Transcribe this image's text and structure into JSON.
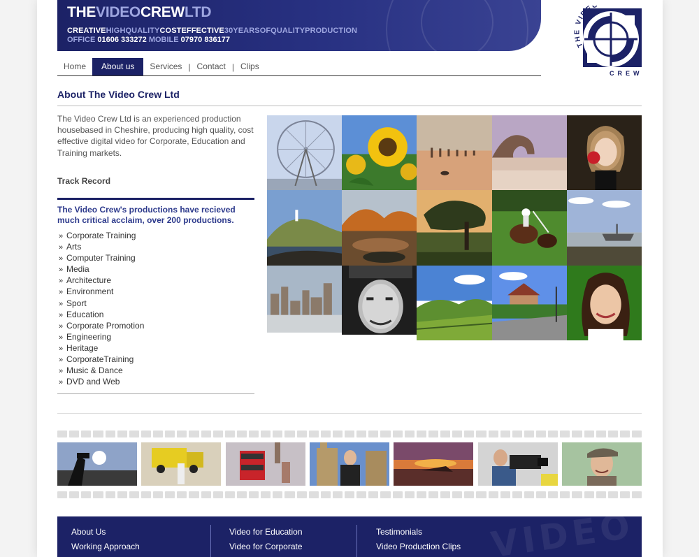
{
  "header": {
    "brand": [
      {
        "text": "THE",
        "tone": "w"
      },
      {
        "text": "VIDEO",
        "tone": "b"
      },
      {
        "text": "CREW",
        "tone": "w"
      },
      {
        "text": "LTD",
        "tone": "b"
      }
    ],
    "tagline": [
      {
        "text": "CREATIVE",
        "tone": "w"
      },
      {
        "text": "HIGHQUALITY",
        "tone": "b"
      },
      {
        "text": "COSTEFFECTIVE",
        "tone": "w"
      },
      {
        "text": "30YEARSOFQUALITYPRODUCTION",
        "tone": "b"
      }
    ],
    "office_label": "OFFICE",
    "office_number": "01606 333272",
    "mobile_label": "MOBILE",
    "mobile_number": "07970 836177",
    "logo_text_top": "THE VIDEO",
    "logo_text_bottom": "CREW"
  },
  "nav": {
    "items": [
      {
        "label": "Home",
        "active": false
      },
      {
        "label": "About us",
        "active": true
      },
      {
        "label": "Services",
        "active": false
      },
      {
        "label": "Contact",
        "active": false
      },
      {
        "label": "Clips",
        "active": false
      }
    ]
  },
  "main": {
    "heading": "About The Video Crew Ltd",
    "intro": "The Video Crew Ltd is an experienced production housebased in Cheshire, producing high quality, cost effective digital video for Corporate, Education and Training markets.",
    "track_record_title": "Track Record",
    "acclaim": "The Video Crew's productions have recieved much critical acclaim, over 200 productions.",
    "list_marker": "»",
    "track_list": [
      "Corporate Training",
      "Arts",
      "Computer Training",
      "Media",
      "Architecture",
      "Environment",
      "Sport",
      "Education",
      "Corporate Promotion",
      "Engineering",
      "Heritage",
      "CorporateTraining",
      "Music & Dance",
      "DVD and Web"
    ]
  },
  "photo_grid": [
    "ferris-wheel",
    "sunflower",
    "beach-groynes",
    "rock-arch",
    "woman-red-flower",
    "coastal-lighthouse",
    "autumn-river",
    "tree-sunset",
    "polo-players",
    "boat-on-shore",
    "city-skyline",
    "old-man-portrait",
    "green-valley",
    "country-house",
    "smiling-girl"
  ],
  "film_strip": [
    "camera-operator-sunset",
    "film-crew-yellow-truck",
    "london-bus",
    "presenter-westminster",
    "beach-sunset",
    "cameraman-closeup",
    "man-flat-cap"
  ],
  "footer": {
    "col1": [
      "About Us",
      "Working Approach"
    ],
    "col2": [
      "Video for Education",
      "Video for Corporate"
    ],
    "col3": [
      "Testimonials",
      "Video Production Clips"
    ]
  },
  "colors": {
    "brand_navy": "#1c2266",
    "brand_light": "#9ea6e0",
    "acclaim_text": "#2d3a8c"
  }
}
